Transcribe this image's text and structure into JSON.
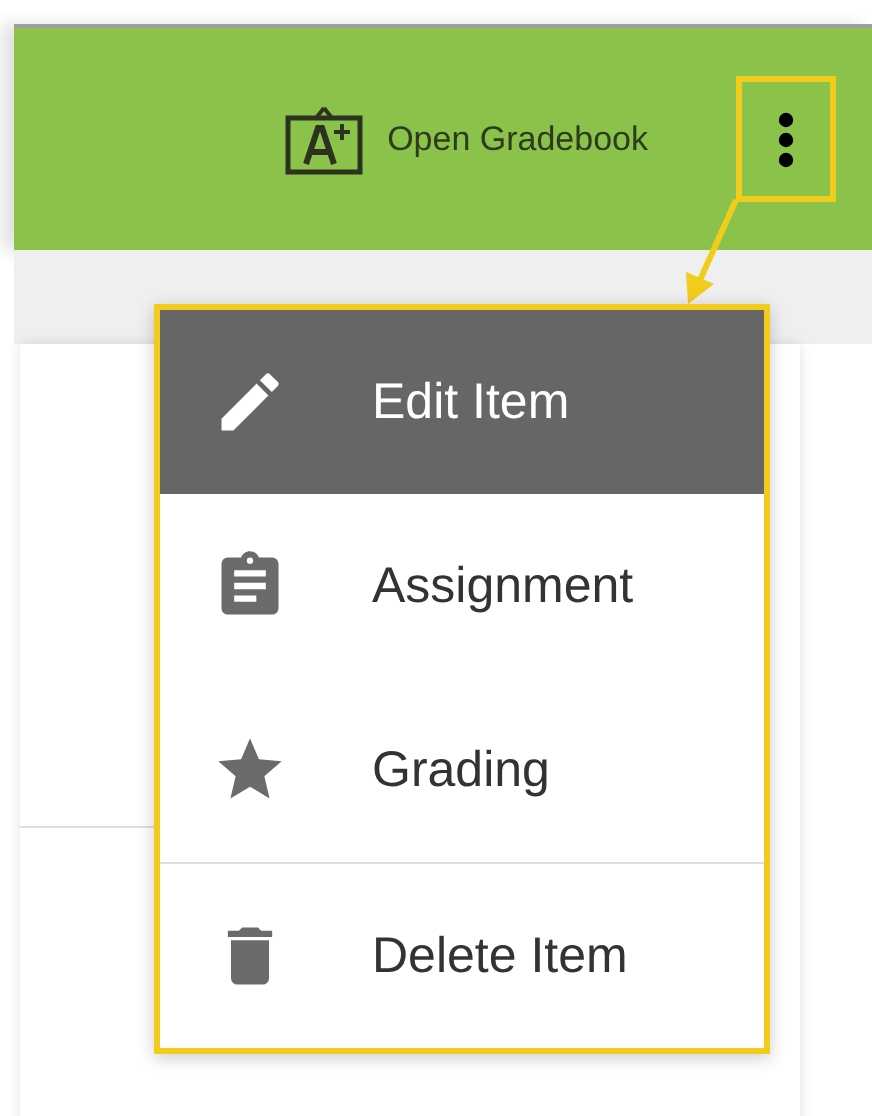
{
  "toolbar": {
    "gradebook_button": {
      "label": "Open Gradebook"
    },
    "more_button": {
      "highlighted": true
    }
  },
  "menu": {
    "highlighted": true,
    "items": [
      {
        "label": "Edit Item",
        "selected": true,
        "divider_before": false
      },
      {
        "label": "Assignment",
        "selected": false,
        "divider_before": false
      },
      {
        "label": "Grading",
        "selected": false,
        "divider_before": false
      },
      {
        "label": "Delete Item",
        "selected": false,
        "divider_before": true
      }
    ]
  }
}
